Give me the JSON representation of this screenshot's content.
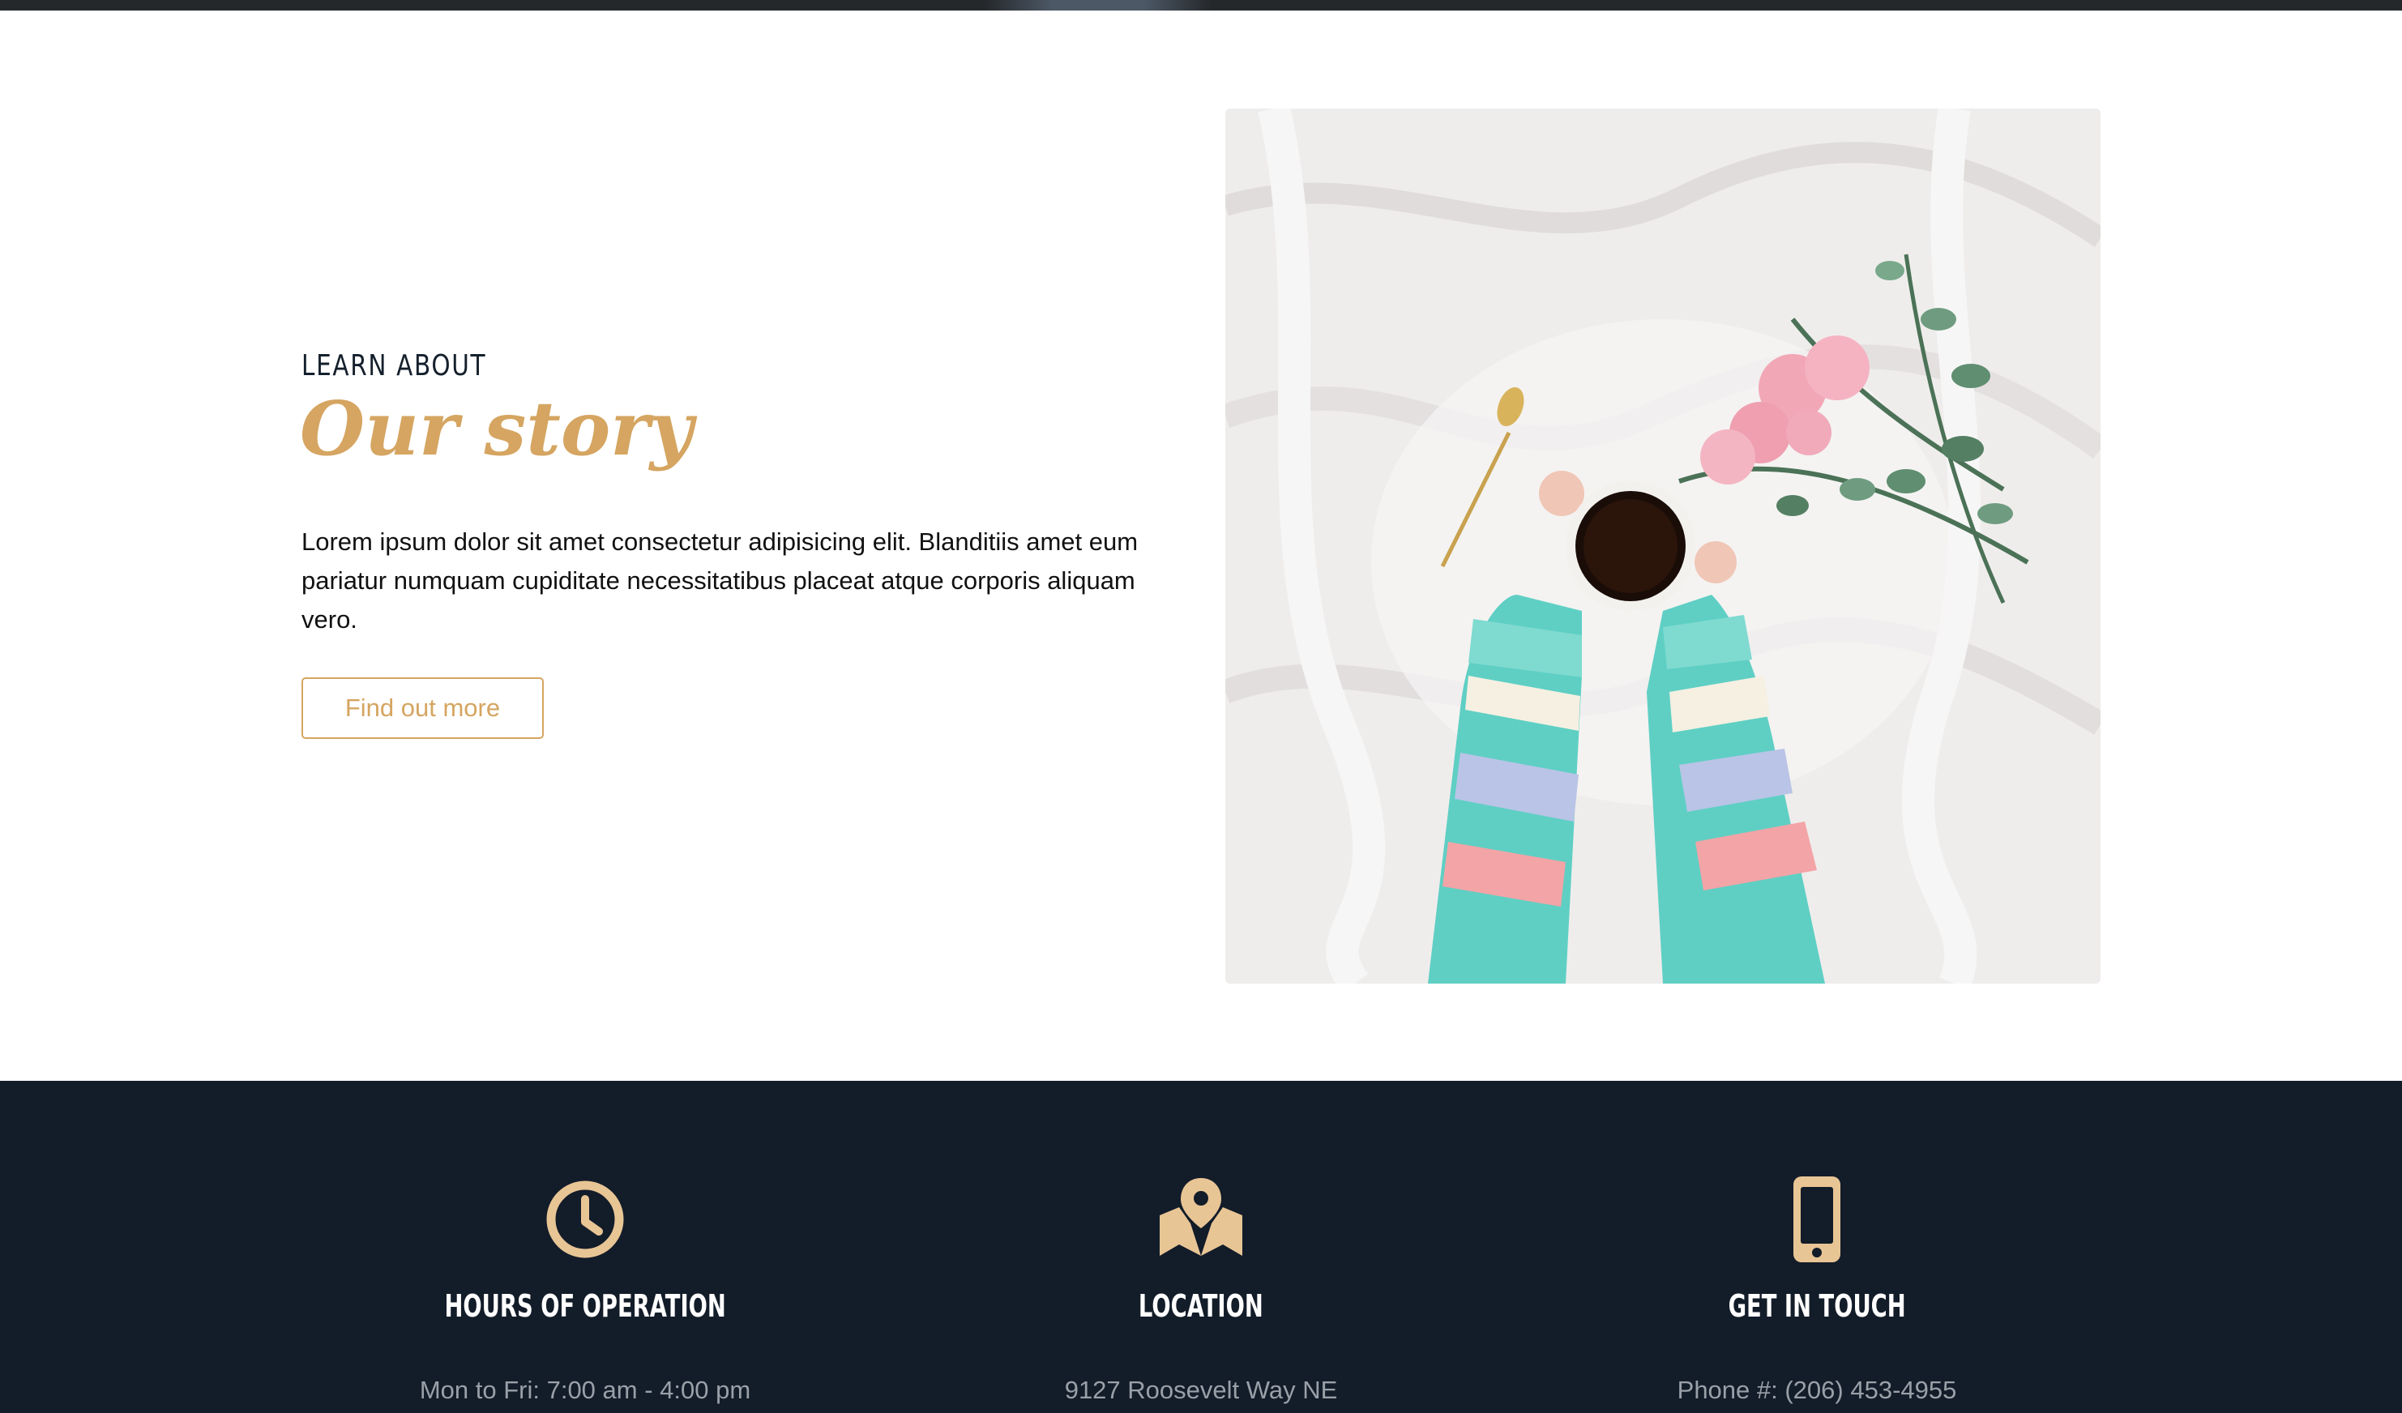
{
  "about": {
    "eyebrow": "LEARN ABOUT",
    "title": "Our story",
    "body": "Lorem ipsum dolor sit amet consectetur adipisicing elit. Blanditiis amet eum pariatur numquam cupiditate necessitatibus placeat atque corporis aliquam vero.",
    "button_label": "Find out more"
  },
  "info": [
    {
      "icon": "clock-icon",
      "heading": "HOURS OF OPERATION",
      "line": "Mon to Fri: 7:00 am - 4:00 pm"
    },
    {
      "icon": "map-marker-icon",
      "heading": "LOCATION",
      "line": "9127 Roosevelt Way NE"
    },
    {
      "icon": "mobile-phone-icon",
      "heading": "GET IN TOUCH",
      "line": "Phone #: (206) 453-4955"
    }
  ],
  "colors": {
    "accent": "#d5a561",
    "icon": "#e8c595",
    "footer_bg": "#131c29",
    "dark_text": "#14202c"
  }
}
